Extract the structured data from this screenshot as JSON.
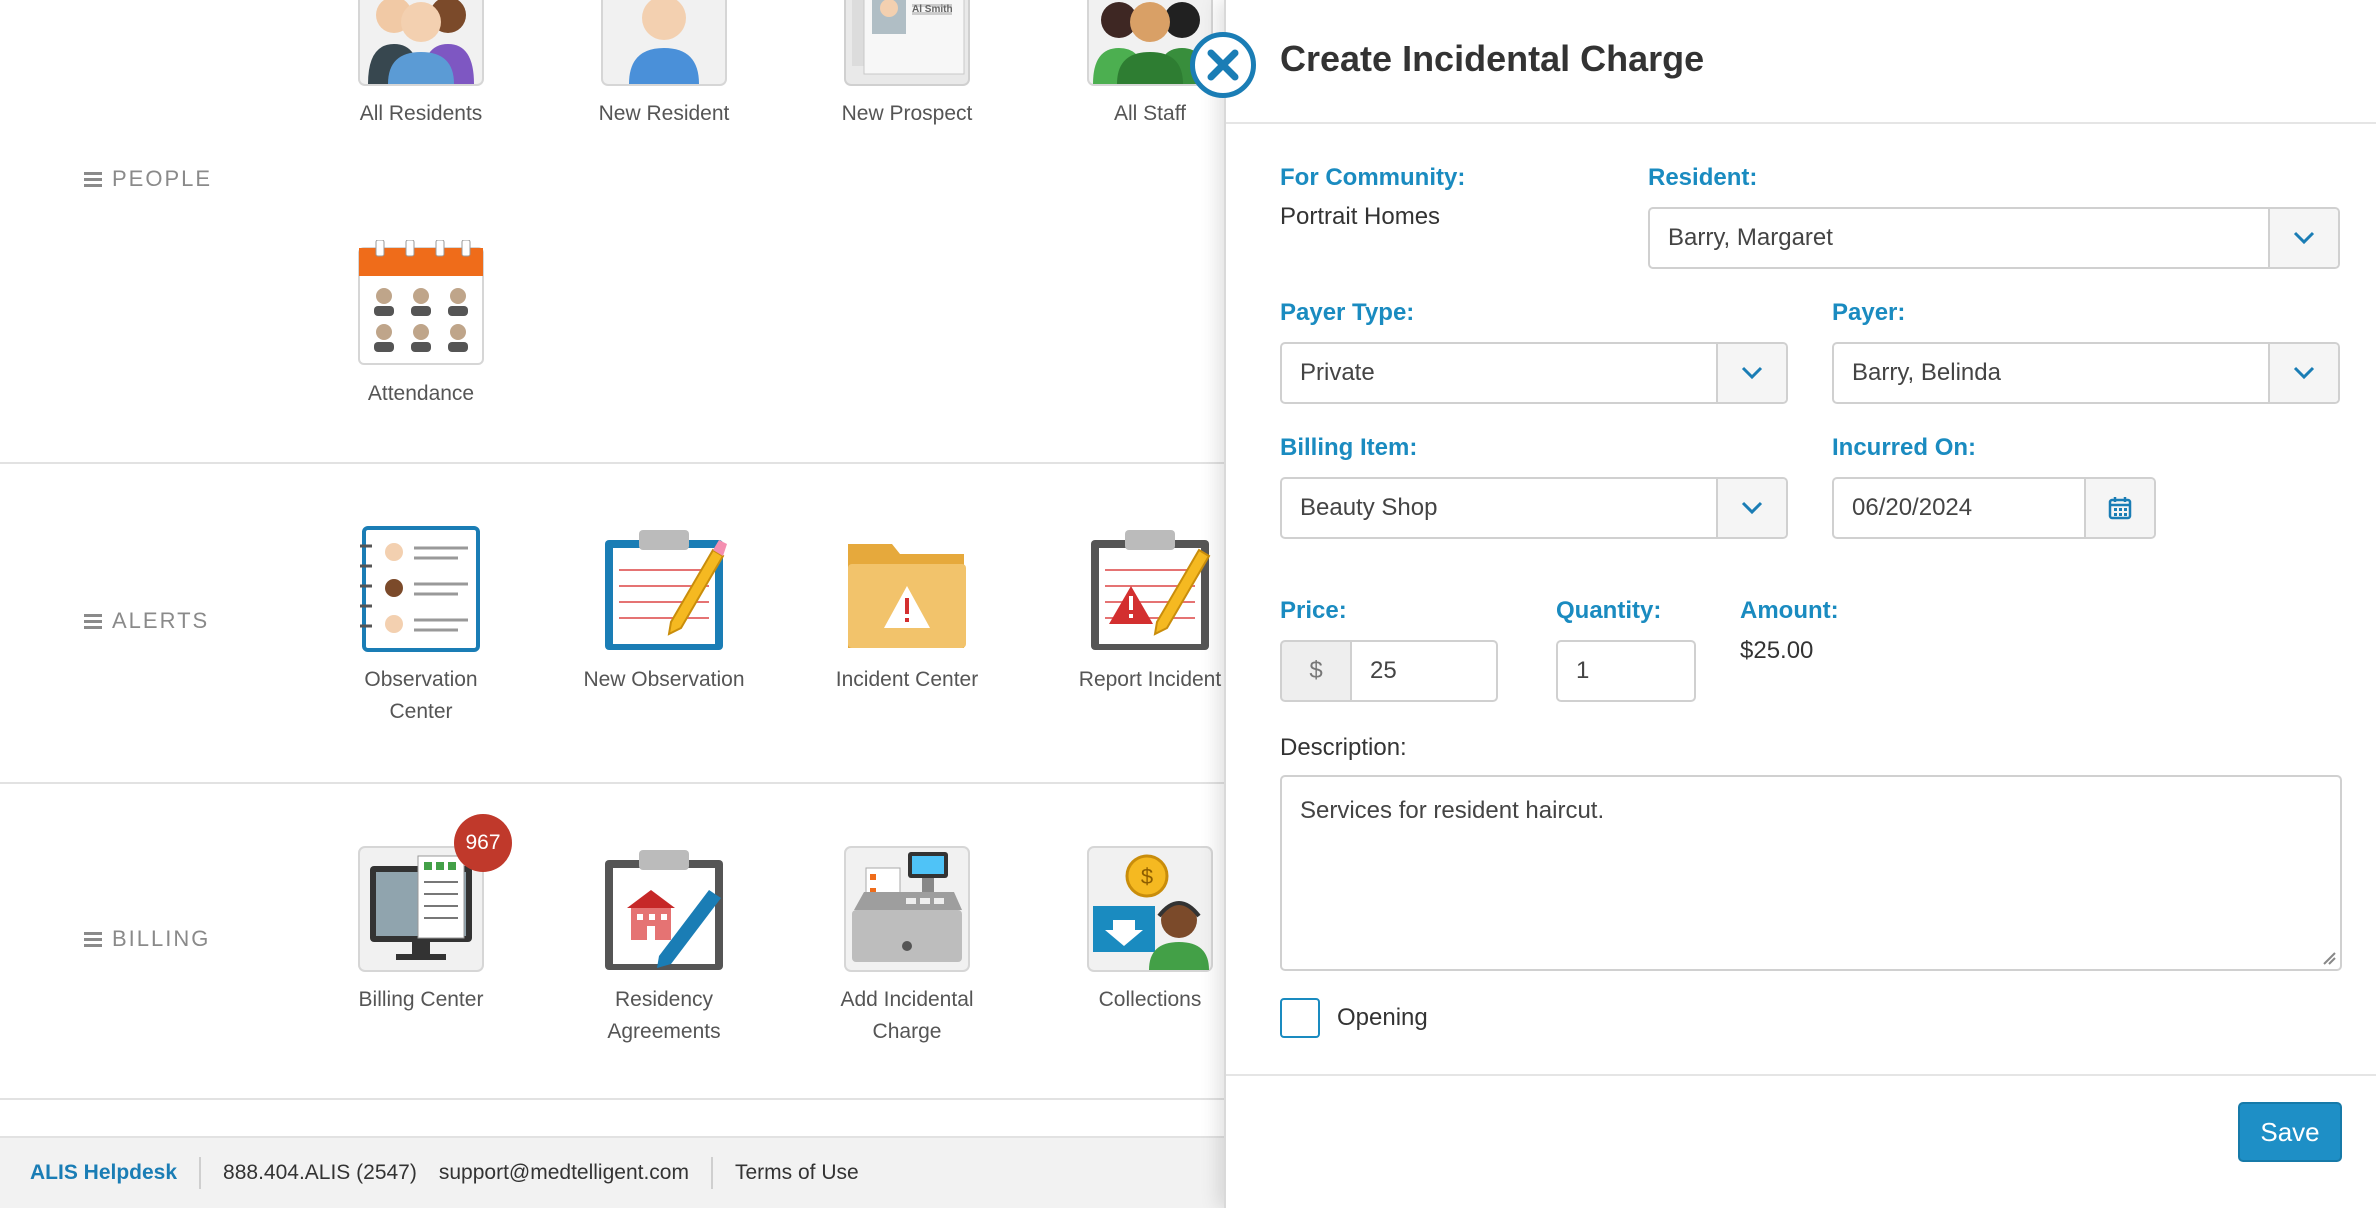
{
  "sections": {
    "people": {
      "label": "PEOPLE",
      "tiles": [
        "All Residents",
        "New Resident",
        "New Prospect",
        "All Staff",
        "Attendance"
      ],
      "prospect_card_name": "Al Smith"
    },
    "alerts": {
      "label": "ALERTS",
      "tiles": [
        "Observation",
        "Center",
        "New Observation",
        "Incident Center",
        "Report Incident"
      ]
    },
    "billing": {
      "label": "BILLING",
      "tiles": [
        "Billing Center",
        "Residency",
        "Agreements",
        "Add Incidental",
        "Charge",
        "Collections"
      ],
      "billing_badge": "967"
    }
  },
  "footer": {
    "helpdesk": "ALIS Helpdesk",
    "phone": "888.404.ALIS (2547)",
    "email": "support@medtelligent.com",
    "terms": "Terms of Use"
  },
  "modal": {
    "title": "Create Incidental Charge",
    "community_label": "For Community:",
    "community_value": "Portrait Homes",
    "resident_label": "Resident:",
    "resident_value": "Barry, Margaret",
    "payer_type_label": "Payer Type:",
    "payer_type_value": "Private",
    "payer_label": "Payer:",
    "payer_value": "Barry, Belinda",
    "billing_item_label": "Billing Item:",
    "billing_item_value": "Beauty Shop",
    "incurred_label": "Incurred On:",
    "incurred_value": "06/20/2024",
    "price_label": "Price:",
    "currency_symbol": "$",
    "price_value": "25",
    "quantity_label": "Quantity:",
    "quantity_value": "1",
    "amount_label": "Amount:",
    "amount_value": "$25.00",
    "description_label": "Description:",
    "description_value": "Services for resident haircut.",
    "opening_label": "Opening",
    "opening_checked": false,
    "save_label": "Save"
  },
  "colors": {
    "accent": "#1a8bc0",
    "badge": "#c0392b",
    "save": "#1e8fc6"
  }
}
